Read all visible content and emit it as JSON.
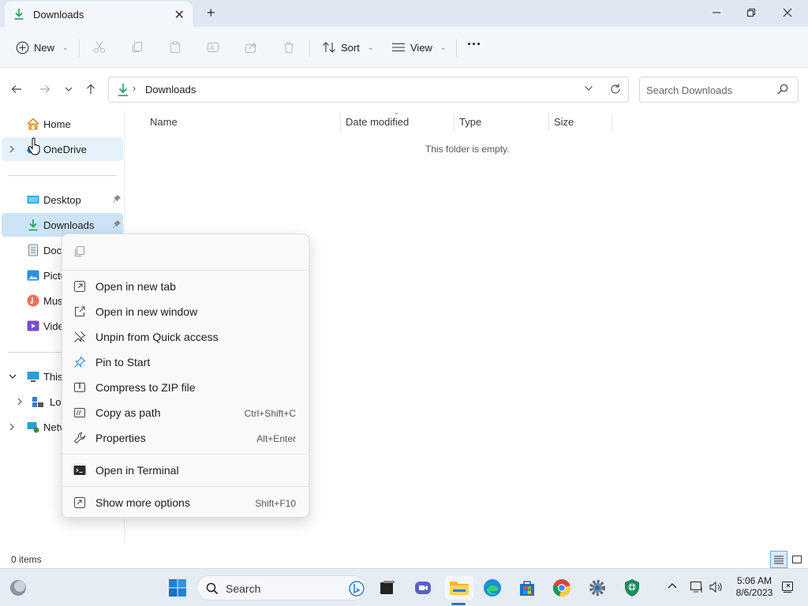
{
  "window": {
    "tab_title": "Downloads",
    "tab_close": "✕",
    "new_tab": "+",
    "minimize": "—",
    "maximize": "❐",
    "close": "✕"
  },
  "toolbar": {
    "new_label": "New",
    "sort_label": "Sort",
    "view_label": "View",
    "more_label": "···",
    "disabled_icons": [
      "cut-icon",
      "copy-icon",
      "paste-icon",
      "rename-icon",
      "share-icon",
      "delete-icon"
    ]
  },
  "address": {
    "current_folder": "Downloads",
    "separator": "›"
  },
  "search": {
    "placeholder": "Search Downloads"
  },
  "sidebar": {
    "items": [
      {
        "label": "Home",
        "icon": "home-icon"
      },
      {
        "label": "OneDrive",
        "icon": "onedrive-icon"
      },
      {
        "label": "Desktop",
        "icon": "desktop-icon",
        "pinned": true
      },
      {
        "label": "Downloads",
        "icon": "downloads-icon",
        "pinned": true,
        "selected": true
      },
      {
        "label": "Doc",
        "icon": "documents-icon"
      },
      {
        "label": "Pictu",
        "icon": "pictures-icon"
      },
      {
        "label": "Musi",
        "icon": "music-icon"
      },
      {
        "label": "Vide",
        "icon": "videos-icon"
      },
      {
        "label": "This",
        "icon": "this-pc-icon"
      },
      {
        "label": "Lo",
        "icon": "local-disk-icon"
      },
      {
        "label": "Netv",
        "icon": "network-icon"
      }
    ]
  },
  "columns": [
    "Name",
    "Date modified",
    "Type",
    "Size"
  ],
  "content": {
    "empty_message": "This folder is empty."
  },
  "status": {
    "item_count": "0 items"
  },
  "context_menu": {
    "items": [
      {
        "label": "Open in new tab",
        "icon": "open-new-tab-icon",
        "shortcut": ""
      },
      {
        "label": "Open in new window",
        "icon": "open-new-window-icon",
        "shortcut": ""
      },
      {
        "label": "Unpin from Quick access",
        "icon": "unpin-icon",
        "shortcut": ""
      },
      {
        "label": "Pin to Start",
        "icon": "pin-icon",
        "shortcut": ""
      },
      {
        "label": "Compress to ZIP file",
        "icon": "zip-icon",
        "shortcut": ""
      },
      {
        "label": "Copy as path",
        "icon": "copy-path-icon",
        "shortcut": "Ctrl+Shift+C"
      },
      {
        "label": "Properties",
        "icon": "properties-icon",
        "shortcut": "Alt+Enter"
      },
      {
        "label": "Open in Terminal",
        "icon": "terminal-icon",
        "shortcut": ""
      },
      {
        "label": "Show more options",
        "icon": "more-options-icon",
        "shortcut": "Shift+F10"
      }
    ]
  },
  "taskbar": {
    "search_label": "Search",
    "time": "5:06 AM",
    "date": "8/6/2023"
  },
  "colors": {
    "accent": "#0067c0",
    "download_green": "#1e9e5a",
    "selected_bg": "#cce4f7"
  }
}
